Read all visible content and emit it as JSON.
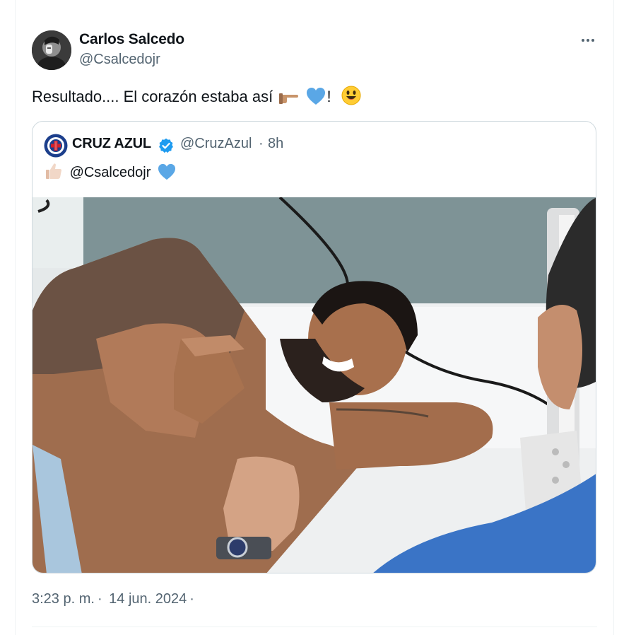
{
  "author": {
    "name": "Carlos Salcedo",
    "handle": "@Csalcedojr"
  },
  "tweet": {
    "text": "Resultado.... El corazón estaba así",
    "exclamation": "!"
  },
  "quoted": {
    "name": "CRUZ AZUL",
    "handle": "@CruzAzul",
    "separator": "·",
    "time": "8h",
    "body": "@Csalcedojr"
  },
  "footer": {
    "time": "3:23 p. m.",
    "sep1": "·",
    "date": "14 jun. 2024",
    "sep2": "·"
  },
  "colors": {
    "text": "#0f1419",
    "secondary": "#536471",
    "border": "#cfd9de",
    "verified": "#1d9bf0",
    "heart": "#5aa7e6"
  },
  "icons": [
    "more-icon",
    "verified-badge-icon",
    "pointing-hand-icon",
    "blue-heart-icon",
    "smiley-icon",
    "thumbs-up-icon"
  ]
}
